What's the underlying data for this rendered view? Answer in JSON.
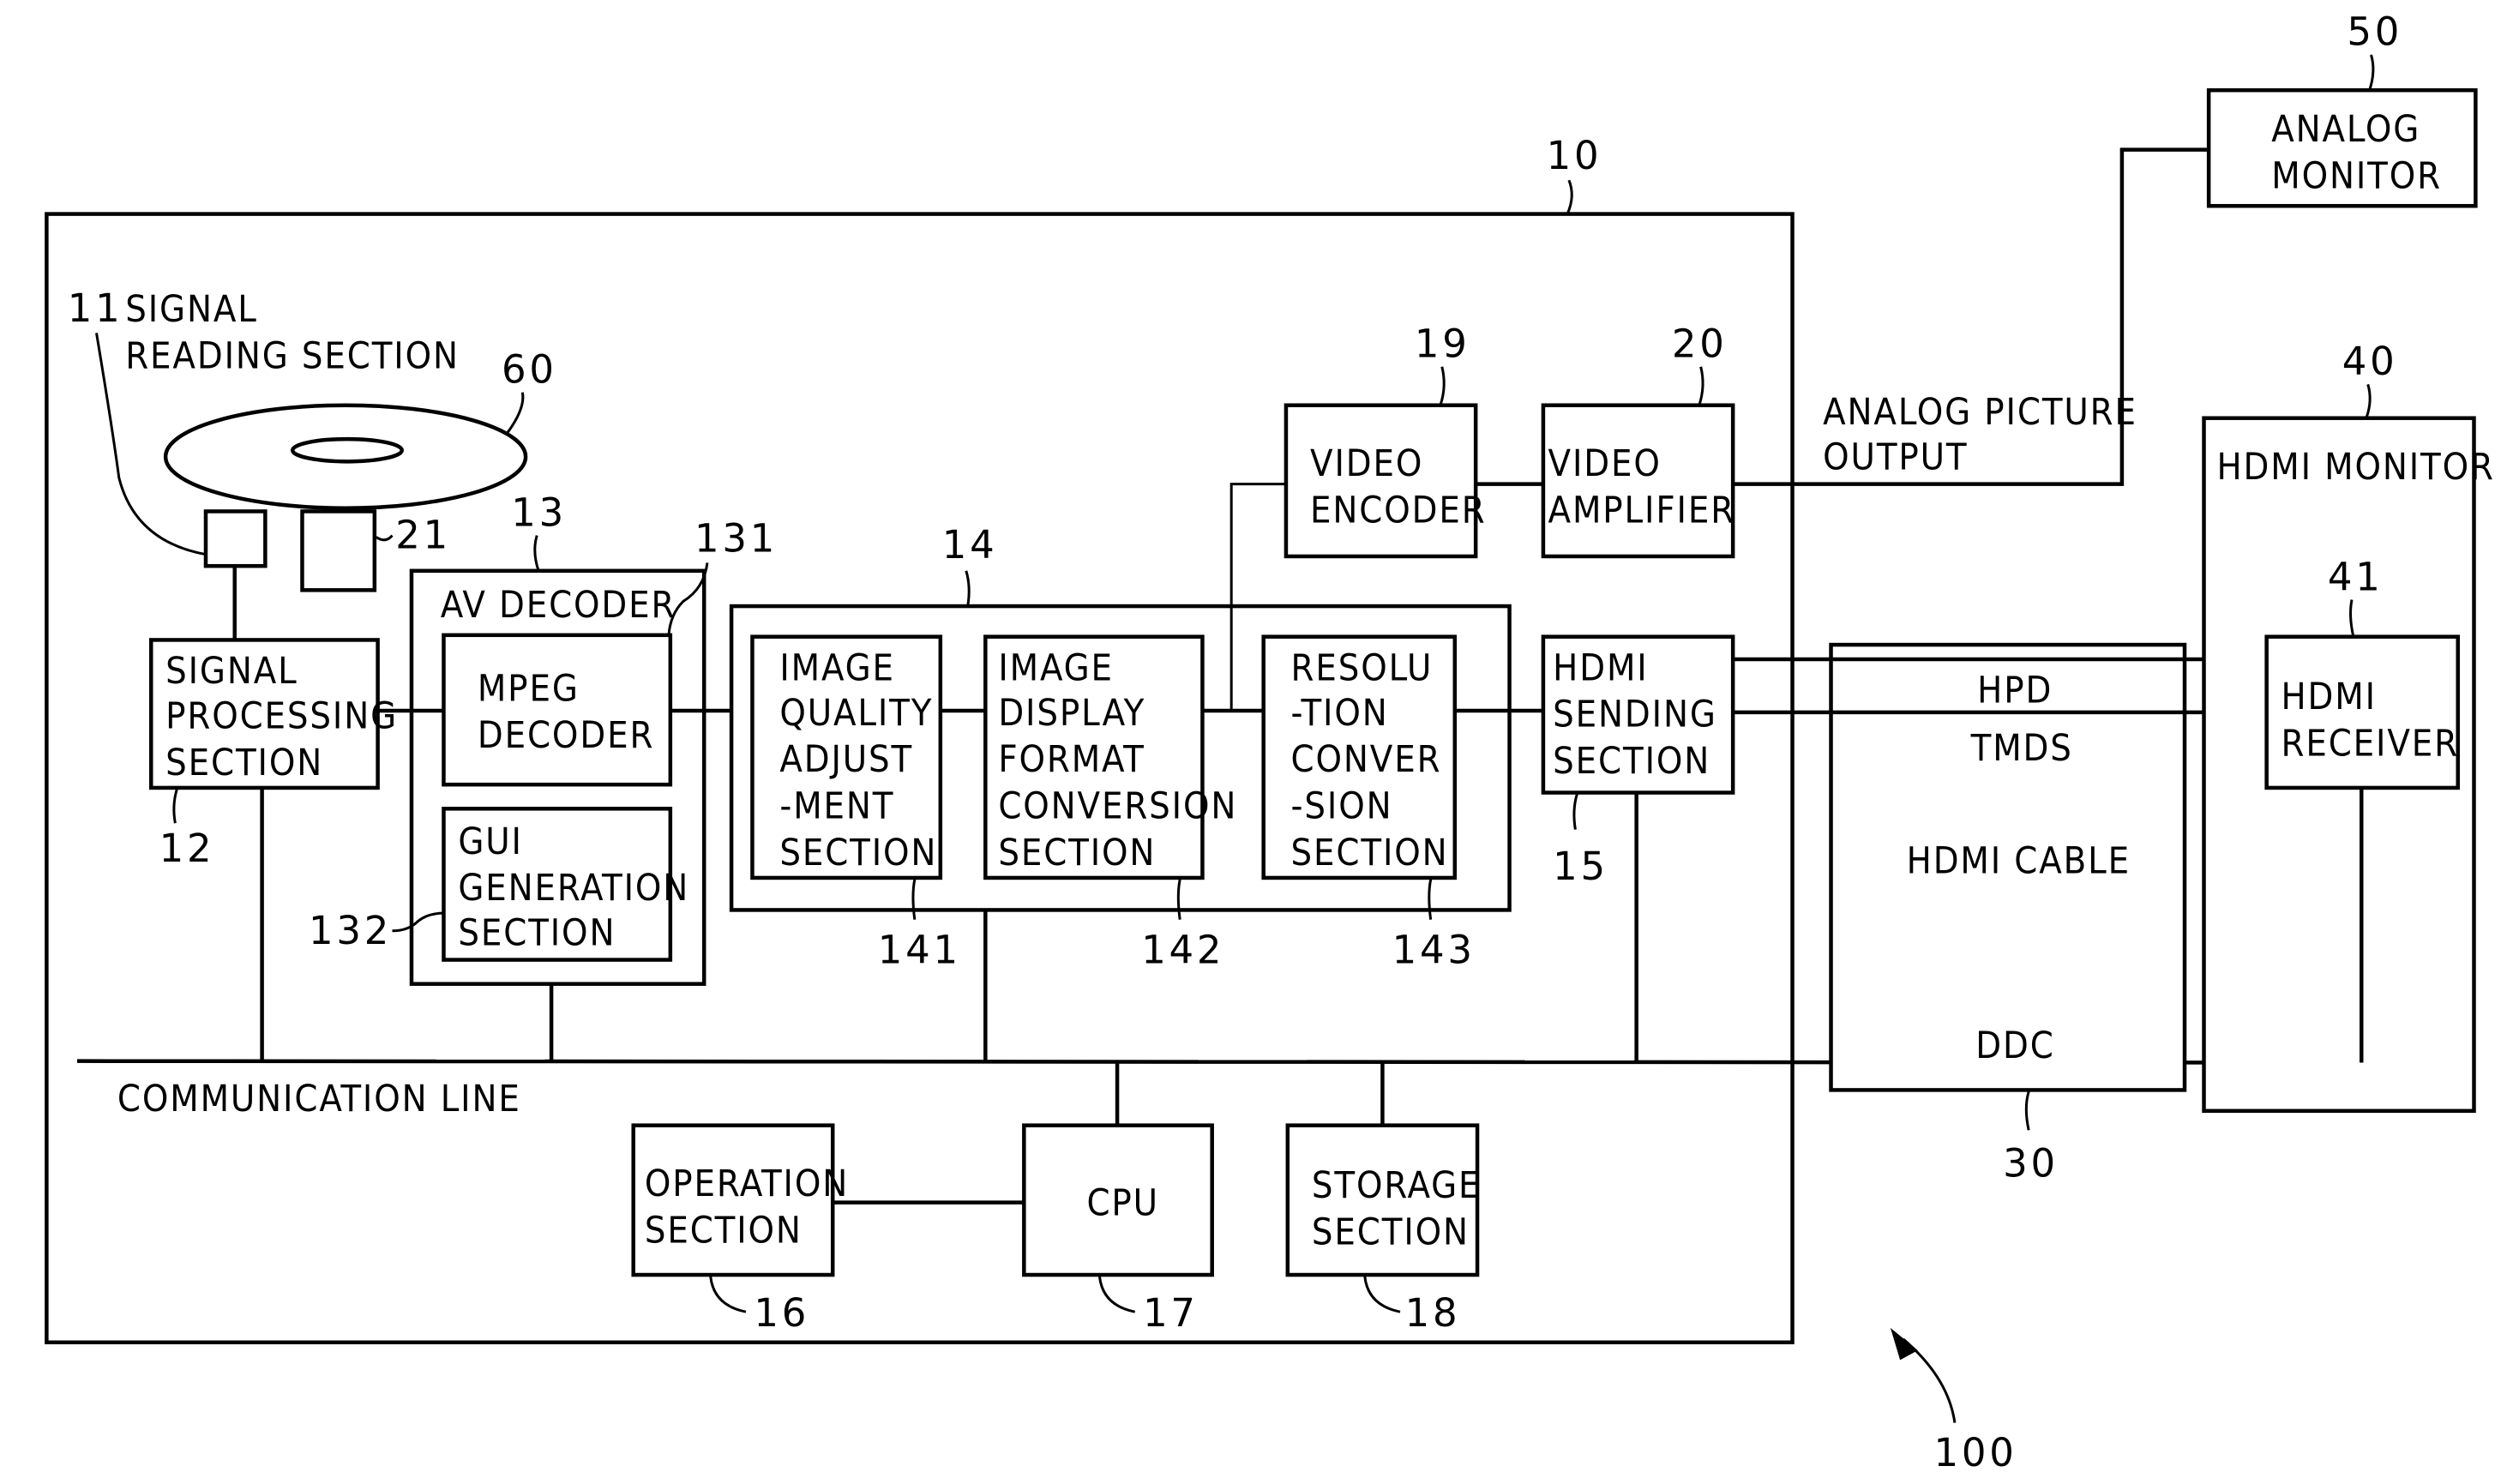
{
  "figure": {
    "system_ref": "100",
    "device": {
      "ref": "10",
      "signal_reading": {
        "ref": "11",
        "label": [
          "SIGNAL",
          "READING SECTION"
        ]
      },
      "disc": {
        "ref": "60"
      },
      "disc_motor": {
        "ref": "21"
      },
      "signal_processing": {
        "ref": "12",
        "label": [
          "SIGNAL",
          "PROCESSING",
          "SECTION"
        ]
      },
      "av_decoder": {
        "ref": "13",
        "label": "AV DECODER",
        "mpeg": {
          "ref": "131",
          "label": [
            "MPEG",
            "DECODER"
          ]
        },
        "gui": {
          "ref": "132",
          "label": [
            "GUI",
            "GENERATION",
            "SECTION"
          ]
        }
      },
      "image_processing": {
        "ref": "14",
        "quality": {
          "ref": "141",
          "label": [
            "IMAGE",
            "QUALITY",
            "ADJUST",
            "-MENT",
            "SECTION"
          ]
        },
        "display_format": {
          "ref": "142",
          "label": [
            "IMAGE",
            "DISPLAY",
            "FORMAT",
            "CONVERSION",
            "SECTION"
          ]
        },
        "resolution": {
          "ref": "143",
          "label": [
            "RESOLU",
            "-TION",
            "CONVER",
            "-SION",
            "SECTION"
          ]
        }
      },
      "hdmi_sending": {
        "ref": "15",
        "label": [
          "HDMI",
          "SENDING",
          "SECTION"
        ]
      },
      "video_encoder": {
        "ref": "19",
        "label": [
          "VIDEO",
          "ENCODER"
        ]
      },
      "video_amplifier": {
        "ref": "20",
        "label": [
          "VIDEO",
          "AMPLIFIER"
        ]
      },
      "communication_line": "COMMUNICATION LINE",
      "operation": {
        "ref": "16",
        "label": [
          "OPERATION",
          "SECTION"
        ]
      },
      "cpu": {
        "ref": "17",
        "label": [
          "CPU"
        ]
      },
      "storage": {
        "ref": "18",
        "label": [
          "STORAGE",
          "SECTION"
        ]
      }
    },
    "analog_output_label": [
      "ANALOG PICTURE",
      "OUTPUT"
    ],
    "analog_monitor": {
      "ref": "50",
      "label": [
        "ANALOG",
        "MONITOR"
      ]
    },
    "hdmi_cable": {
      "ref": "30",
      "label": "HDMI CABLE",
      "signals": {
        "hpd": "HPD",
        "tmds": "TMDS",
        "ddc": "DDC"
      }
    },
    "hdmi_monitor": {
      "ref": "40",
      "label": "HDMI MONITOR",
      "receiver": {
        "ref": "41",
        "label": [
          "HDMI",
          "RECEIVER"
        ]
      }
    }
  }
}
